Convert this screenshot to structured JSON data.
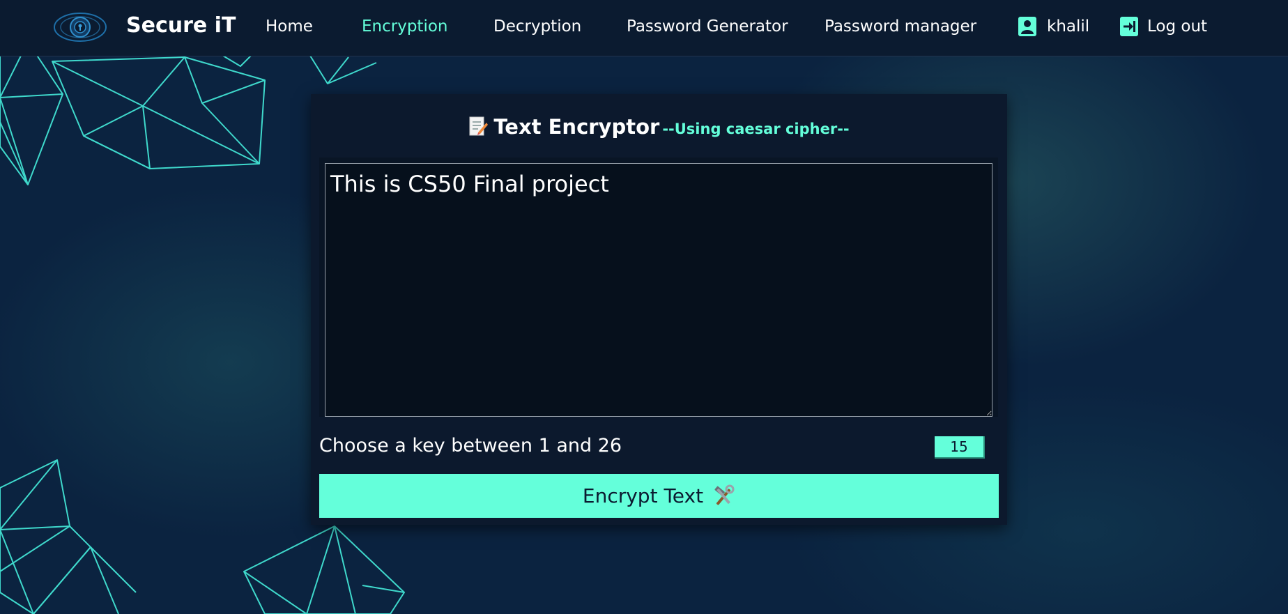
{
  "nav": {
    "brand": "Secure iT",
    "links": [
      {
        "label": "Home",
        "active": false
      },
      {
        "label": "Encryption",
        "active": true
      },
      {
        "label": "Decryption",
        "active": false
      },
      {
        "label": "Password Generator",
        "active": false
      },
      {
        "label": "Password manager",
        "active": false
      }
    ],
    "user": {
      "label": "khalil",
      "icon": "user-icon"
    },
    "logout": {
      "label": "Log out",
      "icon": "logout-icon"
    }
  },
  "card": {
    "title_icon": "memo-icon",
    "title": "Text Encryptor",
    "subtitle": "--Using caesar cipher--",
    "message": "This is CS50 Final project",
    "key_label": "Choose a key between 1 and 26",
    "key_value": "15",
    "button_label": "Encrypt Text",
    "button_icon": "hammer-wrench-icon"
  },
  "colors": {
    "accent": "#64ffda",
    "navbar": "#0b1b30",
    "card": "#0c192d",
    "background": "#0b2340"
  }
}
